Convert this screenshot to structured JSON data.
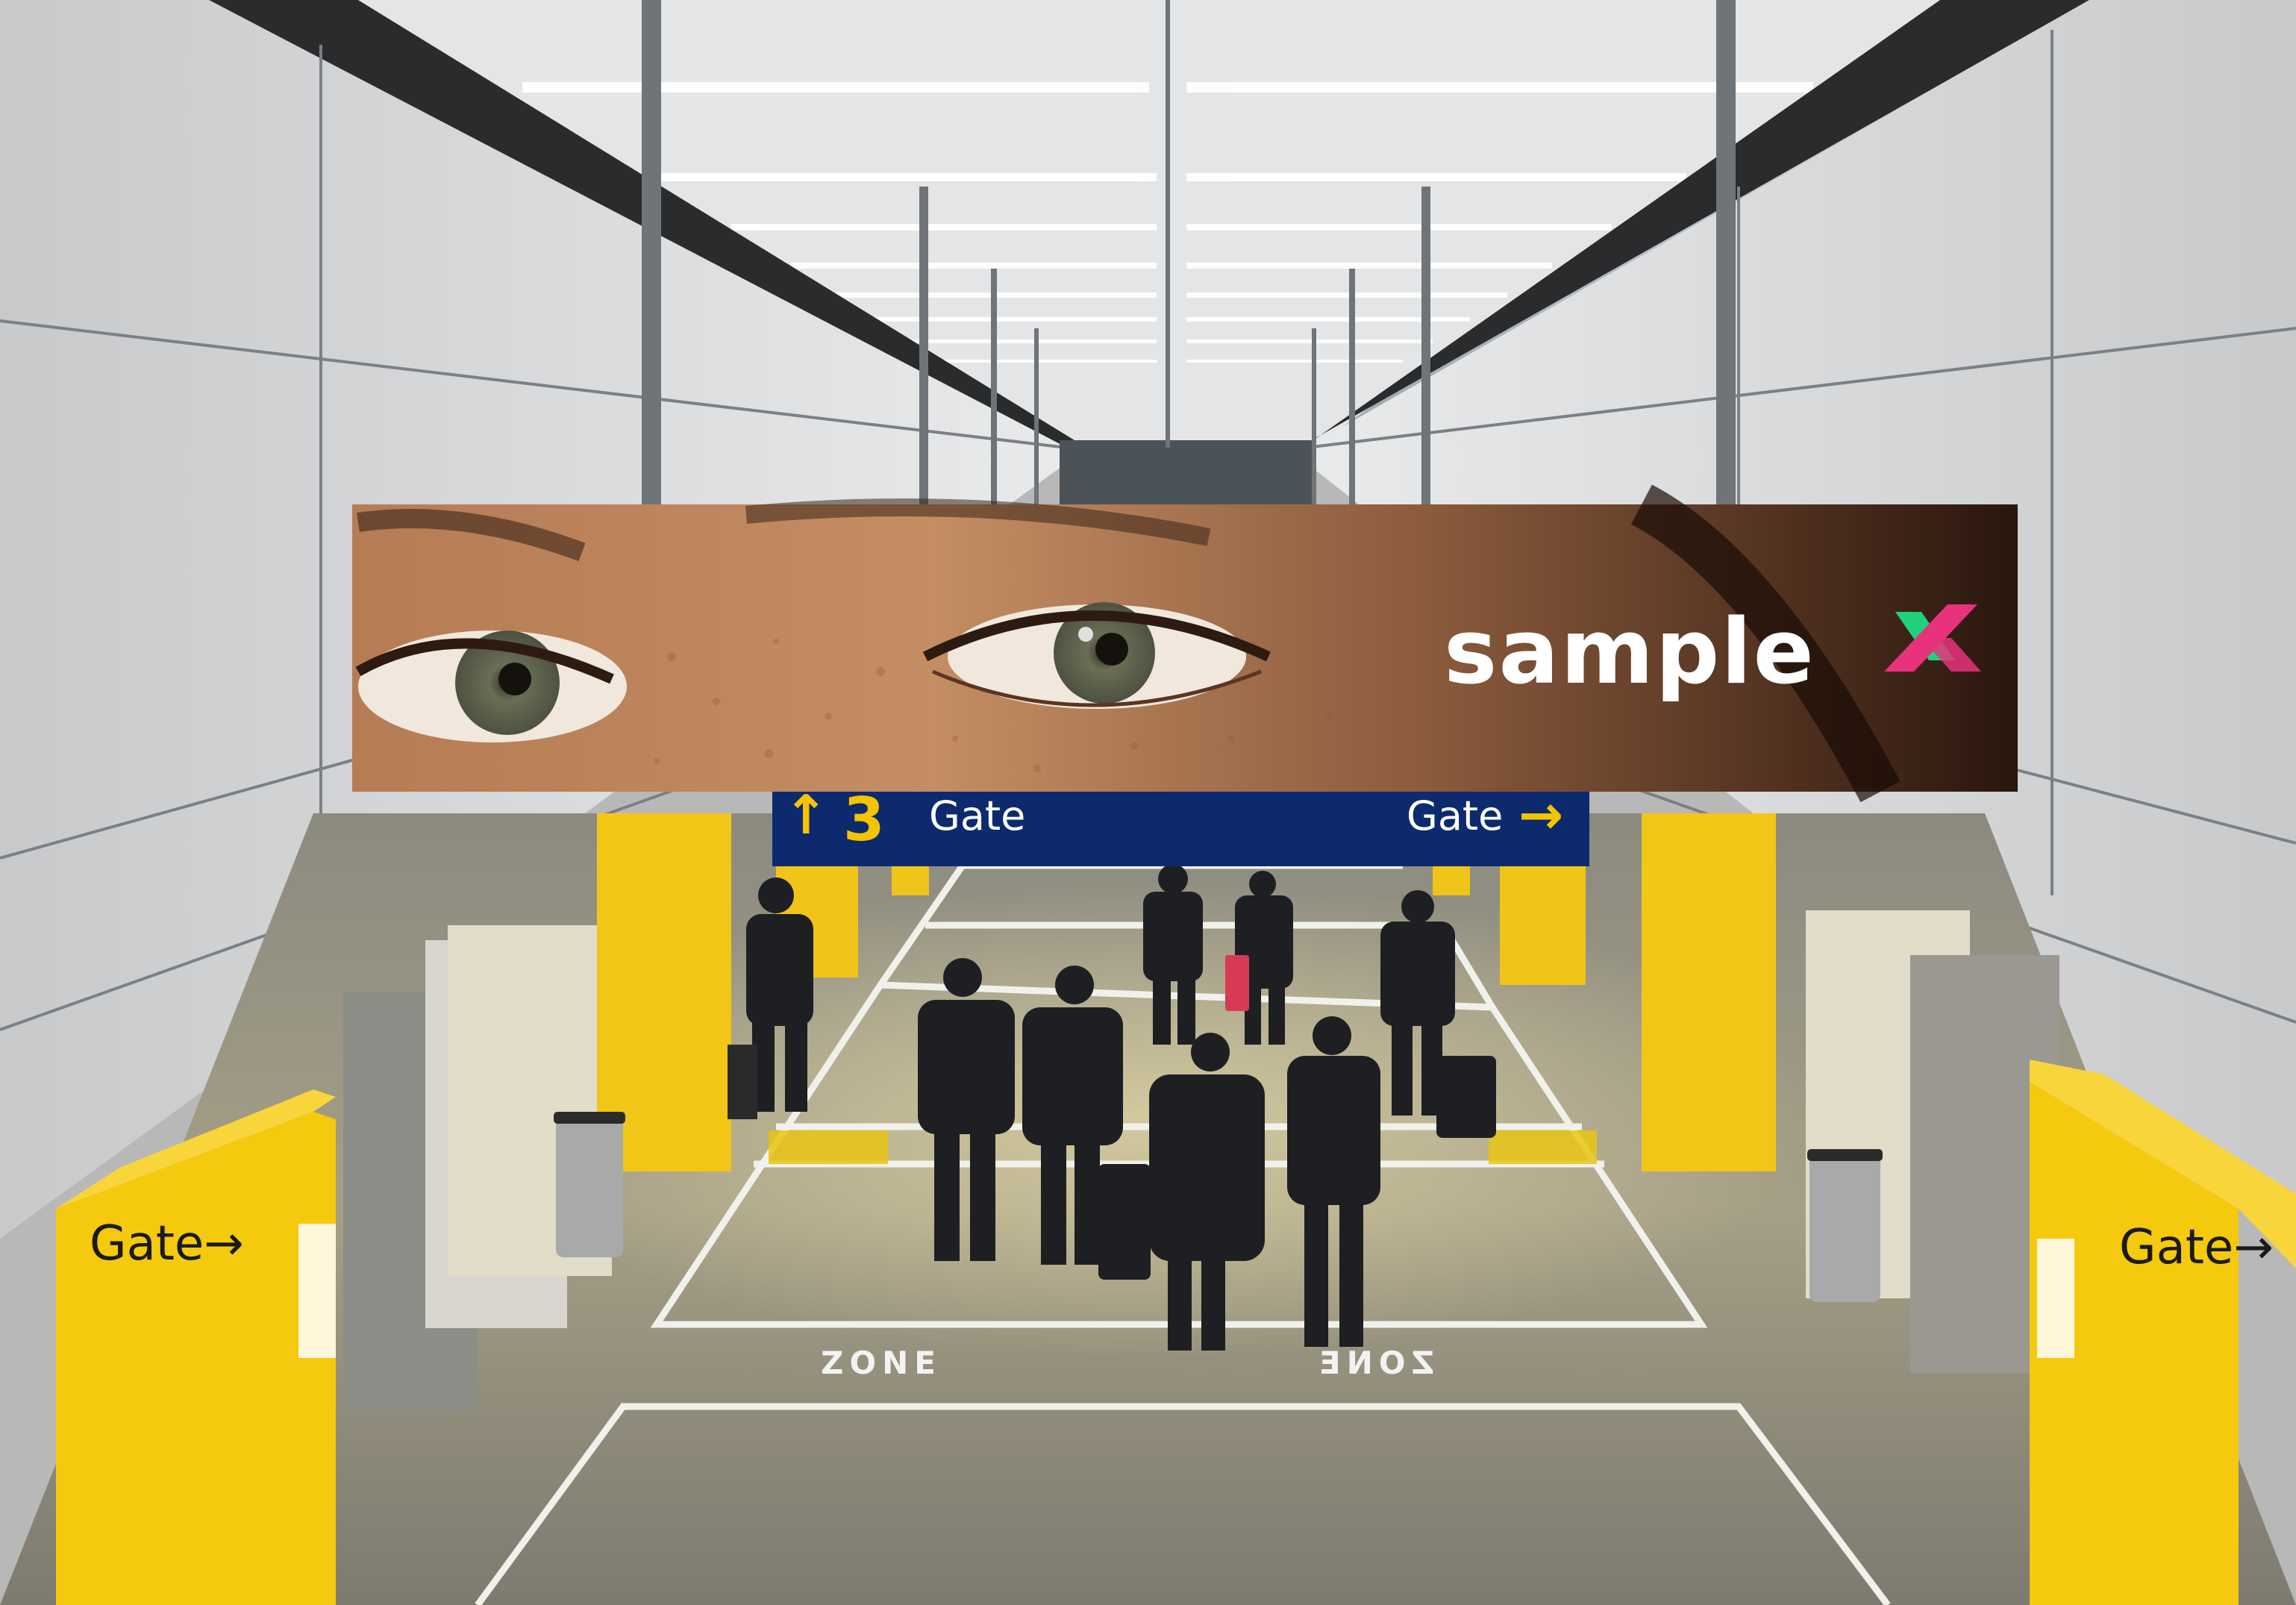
{
  "scene": {
    "banner": {
      "brand_main": "sample",
      "brand_x": "X",
      "brand_x_color_a": "#1fd17a",
      "brand_x_color_b": "#e8327c"
    },
    "overhead_sign": {
      "left_arrow": "↑",
      "left_number": "3",
      "left_label": "Gate",
      "right_label": "Gate",
      "right_arrow": "→",
      "background_color": "#0d2a6e",
      "accent_color": "#f5c400"
    },
    "pillars": {
      "left_label": "Gate",
      "left_arrow": "→",
      "right_label": "Gate",
      "right_arrow": "→",
      "color": "#f5c400"
    },
    "floor": {
      "zone_left": "ZONE",
      "zone_right": "ZONE"
    }
  }
}
